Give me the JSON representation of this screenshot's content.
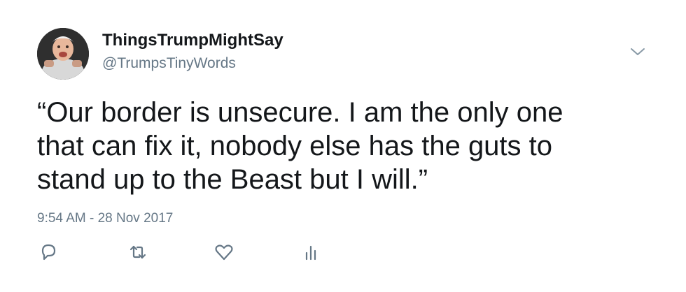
{
  "user": {
    "display_name": "ThingsTrumpMightSay",
    "handle": "@TrumpsTinyWords"
  },
  "tweet": {
    "text_lines": [
      "“Our border is unsecure. I am the only one",
      "that can fix it, nobody else has the guts to",
      "stand up to the Beast but I will.”"
    ],
    "timestamp": "9:54 AM - 28 Nov 2017"
  },
  "icons": {
    "avatar": "profile-photo",
    "menu": "chevron-down-icon",
    "reply": "reply-icon",
    "retweet": "retweet-icon",
    "like": "heart-icon",
    "analytics": "analytics-icon"
  },
  "colors": {
    "text": "#14171a",
    "secondary": "#657786"
  }
}
